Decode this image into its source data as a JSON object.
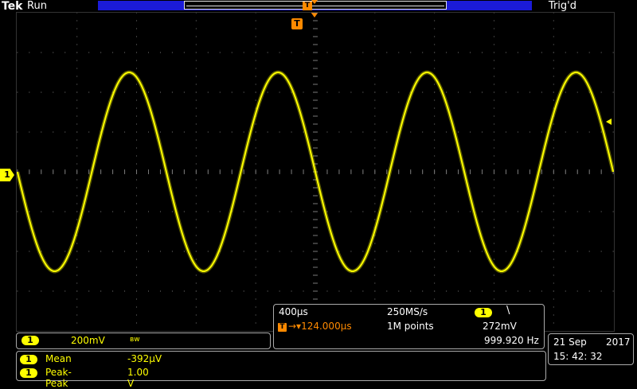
{
  "header": {
    "brand": "Tek",
    "run_state": "Run",
    "trigger_state": "Trig'd",
    "record_marker": "T"
  },
  "trigger_position_marker": "T",
  "channel_marker": "1",
  "channel_panel": {
    "channel": "1",
    "scale": "200mV",
    "bandwidth_icon": "ʙw"
  },
  "measurements": [
    {
      "channel": "1",
      "label": "Mean",
      "value": "-392μV"
    },
    {
      "channel": "1",
      "label": "Peak-Peak",
      "value": "1.00 V"
    }
  ],
  "acquisition": {
    "timebase": "400μs",
    "sample_rate": "250MS/s",
    "trigger_channel": "1",
    "trigger_slope": "\\",
    "trigger_marker": "T",
    "horizontal_position": "→▾124.000μs",
    "record_length": "1M points",
    "trigger_level": "272mV",
    "frequency": "999.920 Hz"
  },
  "datetime": {
    "date": "21 Sep",
    "year": "2017",
    "time": "15: 42: 32"
  },
  "colors": {
    "trace": "#ffff00",
    "accent": "#ff8a00",
    "record_bar": "#1b1bd8"
  },
  "waveform": {
    "type": "sine",
    "frequency_hz": 999.92,
    "amplitude_v": 0.5,
    "volts_per_div": 0.2,
    "seconds_per_div": 0.0004
  }
}
